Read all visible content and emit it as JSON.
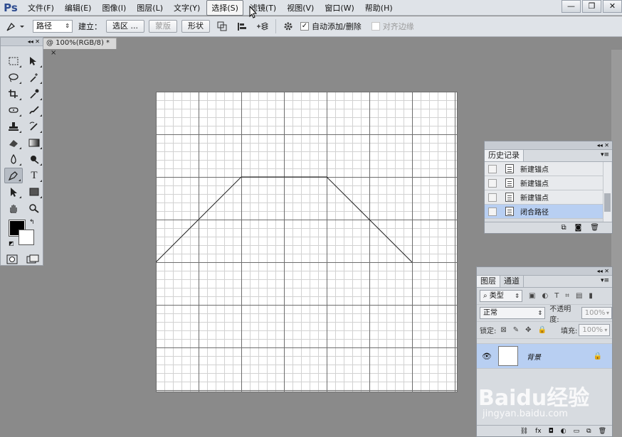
{
  "app": {
    "logo": "Ps"
  },
  "menu": {
    "items": [
      "文件(F)",
      "编辑(E)",
      "图像(I)",
      "图层(L)",
      "文字(Y)",
      "选择(S)",
      "滤镜(T)",
      "视图(V)",
      "窗口(W)",
      "帮助(H)"
    ],
    "active_index": 5
  },
  "window_controls": {
    "minimize": "—",
    "restore": "❐",
    "close": "✕"
  },
  "options": {
    "mode_select": "路径",
    "make_label": "建立：",
    "selection_btn": "选区 ...",
    "mask_btn": "蒙版",
    "shape_btn": "形状",
    "auto_add_delete": "自动添加/删除",
    "auto_add_checked": true,
    "align_edges": "对齐边缘",
    "align_edges_enabled": false
  },
  "document_tab": {
    "title": "@ 100%(RGB/8) *",
    "close": "×"
  },
  "history": {
    "tab": "历史记录",
    "items": [
      {
        "label": "新建锚点",
        "selected": false
      },
      {
        "label": "新建锚点",
        "selected": false
      },
      {
        "label": "新建锚点",
        "selected": false
      },
      {
        "label": "闭合路径",
        "selected": true
      }
    ]
  },
  "layers": {
    "tabs": [
      "图层",
      "通道"
    ],
    "filter_kind": "类型",
    "blend_mode": "正常",
    "opacity_label": "不透明度:",
    "opacity_value": "100%",
    "lock_label": "锁定:",
    "fill_label": "填充:",
    "fill_value": "100%",
    "layer_name": "背景"
  },
  "watermark": {
    "logo": "Baidu经验",
    "url": "jingyan.baidu.com"
  }
}
